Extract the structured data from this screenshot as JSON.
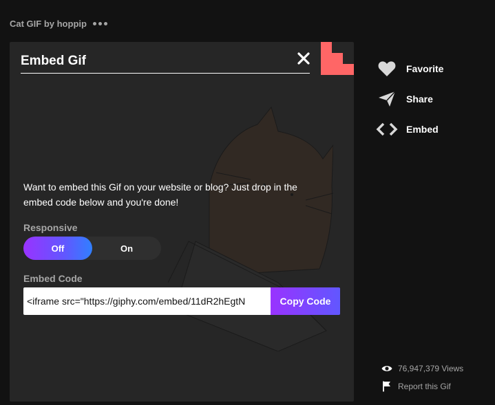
{
  "gif": {
    "title": "Cat GIF by hoppip",
    "more_icon": "more-dots-icon"
  },
  "embed_panel": {
    "title": "Embed Gif",
    "close_icon": "close-icon",
    "description": "Want to embed this Gif on your website or blog? Just drop in the embed code below and you're done!",
    "responsive_label": "Responsive",
    "toggle": {
      "off_label": "Off",
      "on_label": "On",
      "selected": "Off"
    },
    "embed_code_label": "Embed Code",
    "embed_code_value": "<iframe src=\"https://giphy.com/embed/11dR2hEgtN",
    "copy_button_label": "Copy Code"
  },
  "actions": [
    {
      "label": "Favorite",
      "icon": "heart-icon"
    },
    {
      "label": "Share",
      "icon": "paper-plane-icon"
    },
    {
      "label": "Embed",
      "icon": "code-brackets-icon"
    }
  ],
  "stats": {
    "views": "76,947,379 Views",
    "views_icon": "eye-icon",
    "report": "Report this Gif",
    "report_icon": "flag-icon"
  },
  "colors": {
    "background": "#121212",
    "panel": "#262626",
    "accent_purple": "#9933ff",
    "accent_indigo": "#6157ff",
    "accent_blue": "#00a8ff",
    "corner_red": "#ff6666",
    "muted_text": "#a6a6a6"
  }
}
